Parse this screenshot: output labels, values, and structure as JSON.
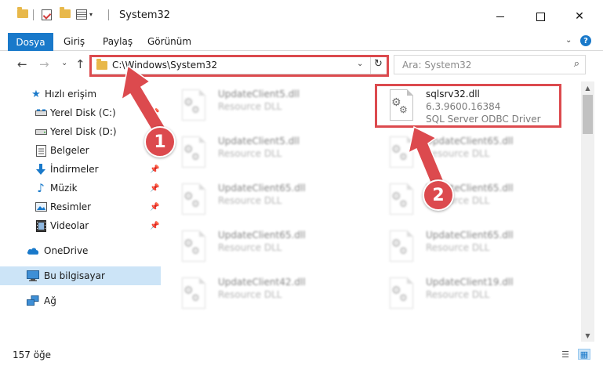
{
  "window": {
    "title": "System32",
    "minimize_glyph": "—",
    "maximize_glyph": "☐",
    "close_glyph": "✕"
  },
  "ribbon": {
    "tabs": [
      "Dosya",
      "Giriş",
      "Paylaş",
      "Görünüm"
    ],
    "expand_glyph": "⌄",
    "help_label": "?"
  },
  "nav": {
    "back_glyph": "←",
    "forward_glyph": "→",
    "recent_glyph": "⌄",
    "up_glyph": "↑",
    "address": "C:\\Windows\\System32",
    "address_dropdown_glyph": "⌄",
    "refresh_glyph": "↻",
    "search_placeholder": "Ara: System32",
    "search_icon_glyph": "⌕"
  },
  "sidebar": {
    "items": [
      {
        "label": "Hızlı erişim",
        "icon": "star-icon"
      },
      {
        "label": "Yerel Disk (C:)",
        "icon": "drive-c-icon"
      },
      {
        "label": "Yerel Disk (D:)",
        "icon": "drive-d-icon"
      },
      {
        "label": "Belgeler",
        "icon": "documents-icon"
      },
      {
        "label": "İndirmeler",
        "icon": "downloads-icon"
      },
      {
        "label": "Müzik",
        "icon": "music-icon"
      },
      {
        "label": "Resimler",
        "icon": "pictures-icon"
      },
      {
        "label": "Videolar",
        "icon": "videos-icon"
      },
      {
        "label": "OneDrive",
        "icon": "onedrive-icon"
      },
      {
        "label": "Bu bilgisayar",
        "icon": "this-pc-icon"
      },
      {
        "label": "Ağ",
        "icon": "network-icon"
      }
    ],
    "pin_glyph": "📌"
  },
  "files": [
    {
      "name": "UpdateClient5.dll",
      "type": "Resource DLL",
      "col": 0,
      "row": 0
    },
    {
      "name": "sqlsrv32.dll",
      "version": "6.3.9600.16384",
      "type": "SQL Server ODBC Driver",
      "col": 1,
      "row": 0,
      "highlighted": true
    },
    {
      "name": "UpdateClient5.dll",
      "type": "Resource DLL",
      "col": 0,
      "row": 1
    },
    {
      "name": "UpdateClient65.dll",
      "type": "Resource DLL",
      "col": 1,
      "row": 1
    },
    {
      "name": "UpdateClient65.dll",
      "type": "Resource DLL",
      "col": 0,
      "row": 2
    },
    {
      "name": "UpdateClient65.dll",
      "type": "Resource DLL",
      "col": 1,
      "row": 2
    },
    {
      "name": "UpdateClient65.dll",
      "type": "Resource DLL",
      "col": 0,
      "row": 3
    },
    {
      "name": "UpdateClient65.dll",
      "type": "Resource DLL",
      "col": 1,
      "row": 3
    },
    {
      "name": "UpdateClient42.dll",
      "type": "Resource DLL",
      "col": 0,
      "row": 4
    },
    {
      "name": "UpdateClient19.dll",
      "type": "Resource DLL",
      "col": 1,
      "row": 4
    }
  ],
  "status": {
    "count": "157 öğe"
  },
  "annotations": {
    "step1": "1",
    "step2": "2",
    "color": "#dc4a4e"
  }
}
